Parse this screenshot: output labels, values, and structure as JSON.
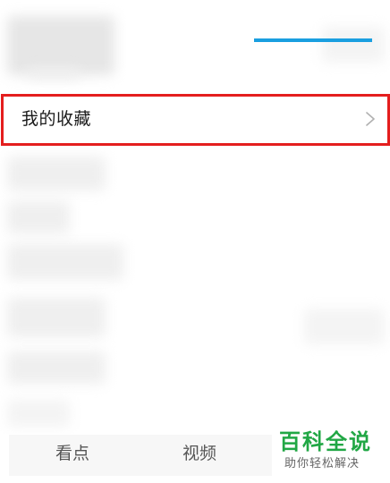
{
  "favorites_row": {
    "label": "我的收藏"
  },
  "bottom_nav": {
    "items": [
      {
        "label": "看点"
      },
      {
        "label": "视频"
      }
    ]
  },
  "watermark": {
    "title": "百科全说",
    "subtitle": "助你轻松解决"
  },
  "colors": {
    "highlight_border": "#e41e1e",
    "nav_active": "#1a9fe0",
    "watermark_green": "#21a745"
  }
}
